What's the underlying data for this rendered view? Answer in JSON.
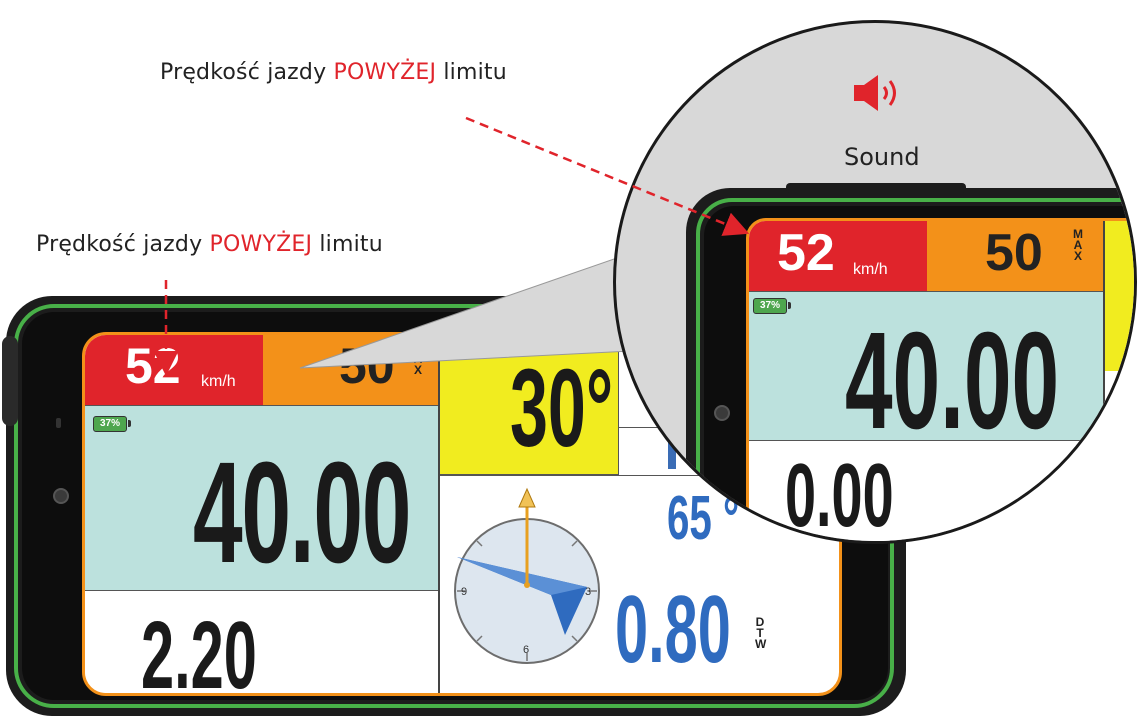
{
  "captions": {
    "top": {
      "prefix": "Prędkość jazdy ",
      "highlight": "POWYŻEJ",
      "suffix": " limitu"
    },
    "left": {
      "prefix": "Prędkość jazdy ",
      "highlight": "POWYŻEJ",
      "suffix": " limitu"
    }
  },
  "sound": {
    "label": "Sound",
    "icon": "speaker-icon",
    "color": "#e0242b"
  },
  "device": {
    "speed": {
      "value": "52",
      "unit": "km/h",
      "bg": "#e0242b"
    },
    "limit": {
      "value": "50",
      "letters": [
        "M",
        "A",
        "X"
      ],
      "bg": "#f39119"
    },
    "battery": {
      "percent": "37%"
    },
    "main_value": "40.00",
    "bottom_value": "2.20",
    "angle": "30°",
    "bearing": "65 °",
    "dtw": {
      "value": "0.80",
      "letters": [
        "D",
        "T",
        "W"
      ]
    },
    "compass": {
      "labels": [
        "3",
        "6",
        "9"
      ]
    }
  },
  "zoom": {
    "speed": "52",
    "unit": "km/h",
    "limit": "50",
    "letters": [
      "M",
      "A",
      "X"
    ],
    "battery": "37%",
    "main_value": "40.00",
    "bottom_value": "0.00"
  }
}
